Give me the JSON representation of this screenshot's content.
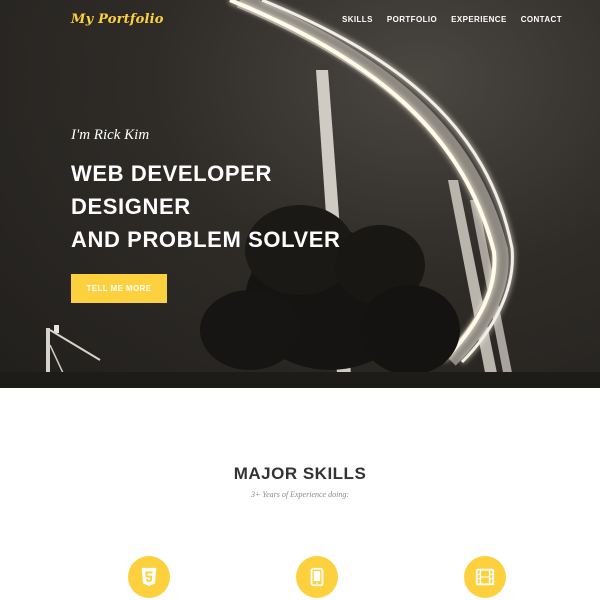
{
  "header": {
    "logo": "My Portfolio",
    "nav": [
      "SKILLS",
      "PORTFOLIO",
      "EXPERIENCE",
      "CONTACT"
    ]
  },
  "hero": {
    "intro": "I'm Rick Kim",
    "headline": [
      "WEB DEVELOPER",
      "DESIGNER",
      "AND PROBLEM SOLVER"
    ],
    "cta_label": "TELL ME MORE"
  },
  "skills": {
    "title": "MAJOR SKILLS",
    "subtitle": "3+ Years of Experience doing:",
    "icons": [
      "html5-icon",
      "tablet-icon",
      "film-icon"
    ]
  },
  "colors": {
    "accent": "#fdd13e",
    "hero_bg": "#2a2824",
    "heading_text": "#333333",
    "subtitle_text": "#8a8a8a"
  }
}
